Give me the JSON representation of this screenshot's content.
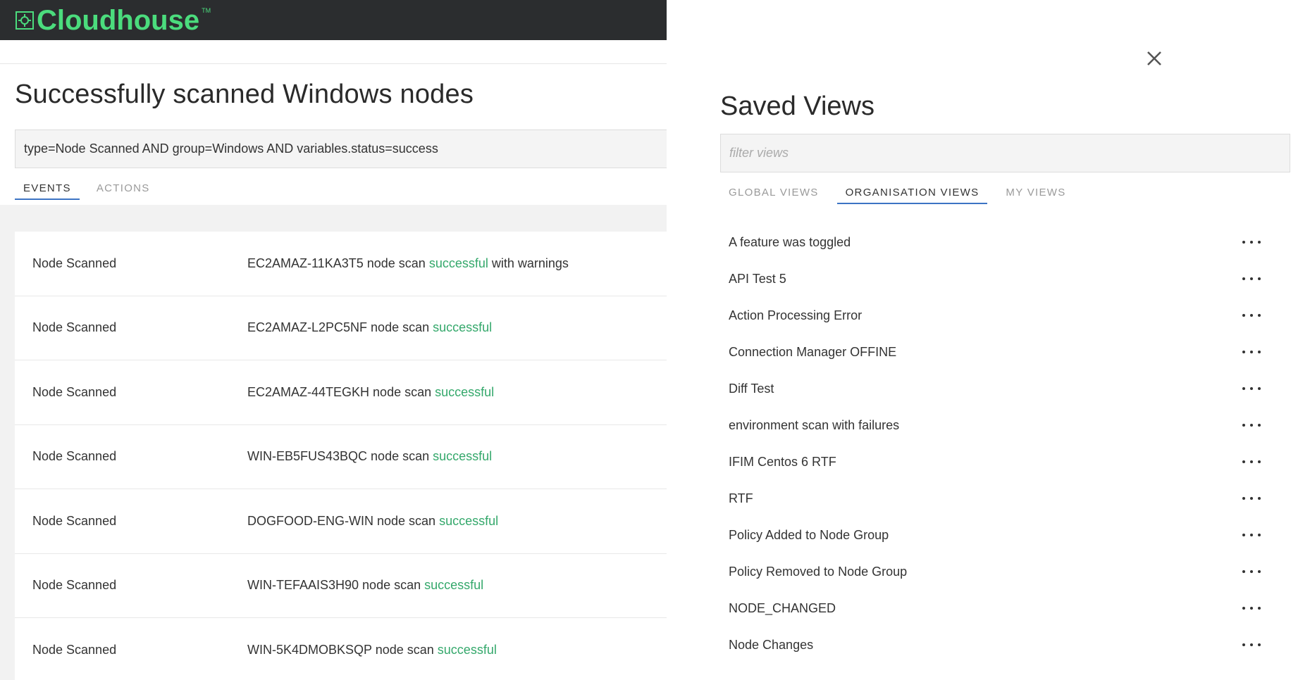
{
  "app": {
    "brand": "Cloudhouse",
    "brand_mark": "TM",
    "brand_color": "#4bdc7d",
    "page_title": "Successfully scanned Windows nodes",
    "query": "type=Node Scanned AND group=Windows AND variables.status=success",
    "tabs": [
      {
        "label": "EVENTS",
        "active": true
      },
      {
        "label": "ACTIONS",
        "active": false
      }
    ],
    "events": [
      {
        "type": "Node Scanned",
        "node": "EC2AMAZ-11KA3T5",
        "mid": " node scan ",
        "status": "successful",
        "suffix": " with warnings"
      },
      {
        "type": "Node Scanned",
        "node": "EC2AMAZ-L2PC5NF",
        "mid": " node scan ",
        "status": "successful",
        "suffix": ""
      },
      {
        "type": "Node Scanned",
        "node": "EC2AMAZ-44TEGKH",
        "mid": " node scan ",
        "status": "successful",
        "suffix": ""
      },
      {
        "type": "Node Scanned",
        "node": "WIN-EB5FUS43BQC",
        "mid": " node scan ",
        "status": "successful",
        "suffix": ""
      },
      {
        "type": "Node Scanned",
        "node": "DOGFOOD-ENG-WIN",
        "mid": " node scan ",
        "status": "successful",
        "suffix": ""
      },
      {
        "type": "Node Scanned",
        "node": "WIN-TEFAAIS3H90",
        "mid": " node scan ",
        "status": "successful",
        "suffix": ""
      },
      {
        "type": "Node Scanned",
        "node": "WIN-5K4DMOBKSQP",
        "mid": " node scan ",
        "status": "successful",
        "suffix": ""
      }
    ],
    "status_color": "#34a86b"
  },
  "panel": {
    "title": "Saved Views",
    "filter_placeholder": "filter views",
    "tabs": [
      {
        "label": "GLOBAL VIEWS",
        "active": false
      },
      {
        "label": "ORGANISATION VIEWS",
        "active": true
      },
      {
        "label": "MY VIEWS",
        "active": false
      }
    ],
    "views": [
      "A feature was toggled",
      "API Test 5",
      "Action Processing Error",
      "Connection Manager OFFINE",
      "Diff Test",
      "environment scan with failures",
      "IFIM Centos 6 RTF",
      "RTF",
      "Policy Added to Node Group",
      "Policy Removed to Node Group",
      "NODE_CHANGED",
      "Node Changes"
    ],
    "accent_color": "#3c74c4"
  }
}
